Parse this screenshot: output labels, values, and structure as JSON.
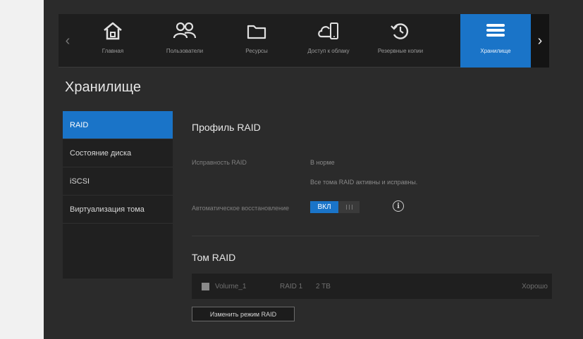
{
  "nav": {
    "items": [
      {
        "label": "Главная",
        "icon": "home-icon"
      },
      {
        "label": "Пользователи",
        "icon": "users-icon"
      },
      {
        "label": "Ресурсы",
        "icon": "folder-icon"
      },
      {
        "label": "Доступ к облаку",
        "icon": "cloud-device-icon"
      },
      {
        "label": "Резервные копии",
        "icon": "backup-history-icon"
      },
      {
        "label": "Хранилище",
        "icon": "storage-icon",
        "active": true
      }
    ]
  },
  "page": {
    "title": "Хранилище"
  },
  "sidebar": {
    "items": [
      {
        "label": "RAID",
        "active": true
      },
      {
        "label": "Состояние диска"
      },
      {
        "label": "iSCSI"
      },
      {
        "label": "Виртуализация тома"
      }
    ]
  },
  "raid_profile": {
    "title": "Профиль RAID",
    "health_label": "Исправность RAID",
    "health_value": "В норме",
    "health_detail": "Все тома RAID активны и исправны.",
    "auto_rebuild_label": "Автоматическое восстановление",
    "auto_rebuild_state": "ВКЛ"
  },
  "raid_volumes": {
    "title": "Том RAID",
    "rows": [
      {
        "name": "Volume_1",
        "raid": "RAID 1",
        "size": "2 TB",
        "status": "Хорошо"
      }
    ]
  },
  "actions": {
    "change_raid_label": "Изменить режим RAID"
  },
  "colors": {
    "accent": "#1a74c8",
    "background": "#2b2b2b",
    "panel": "#202020"
  }
}
